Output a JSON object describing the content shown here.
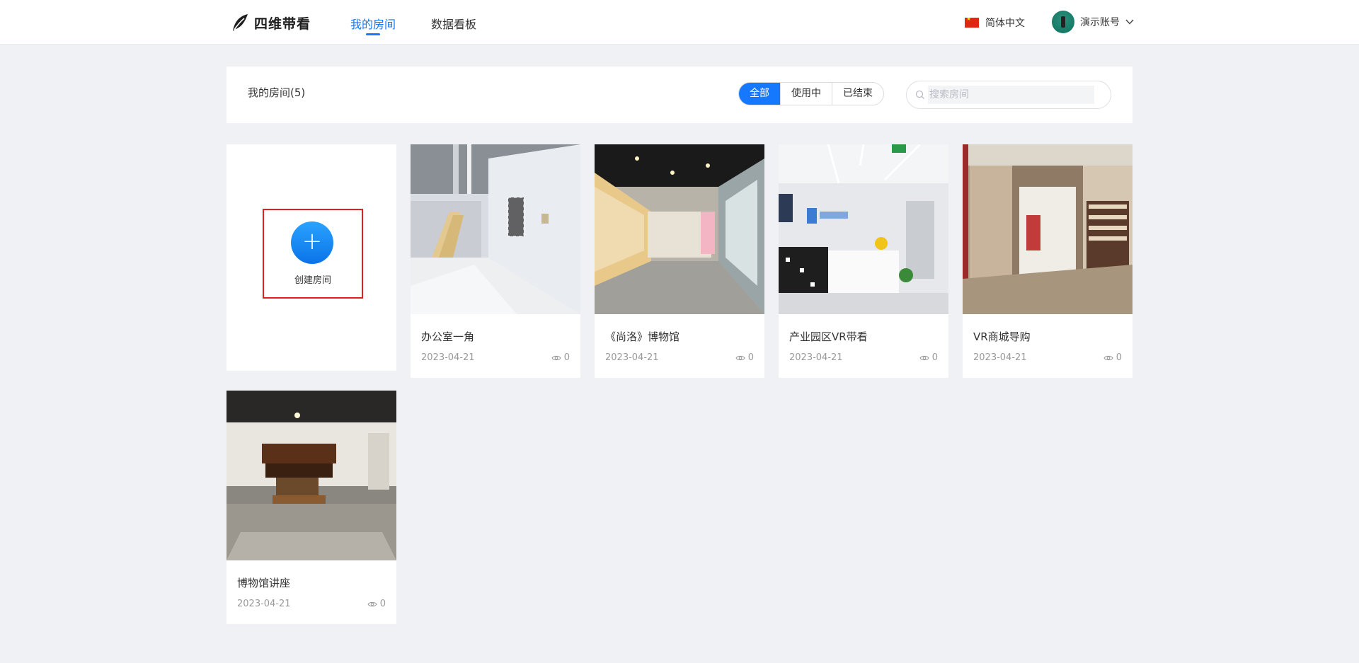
{
  "nav": {
    "logo_text": "四维带看",
    "tabs": [
      {
        "label": "我的房间",
        "active": true
      },
      {
        "label": "数据看板",
        "active": false
      }
    ],
    "language": "简体中文",
    "account": "演示账号"
  },
  "header": {
    "title": "我的房间(5)",
    "filters": [
      {
        "label": "全部",
        "active": true
      },
      {
        "label": "使用中",
        "active": false
      },
      {
        "label": "已结束",
        "active": false
      }
    ],
    "search_placeholder": "搜索房间"
  },
  "create_card": {
    "label": "创建房间"
  },
  "rooms": [
    {
      "name": "办公室一角",
      "date": "2023-04-21",
      "views": "0"
    },
    {
      "name": "《尚洛》博物馆",
      "date": "2023-04-21",
      "views": "0"
    },
    {
      "name": "产业园区VR带看",
      "date": "2023-04-21",
      "views": "0"
    },
    {
      "name": "VR商城导购",
      "date": "2023-04-21",
      "views": "0"
    },
    {
      "name": "博物馆讲座",
      "date": "2023-04-21",
      "views": "0"
    }
  ],
  "colors": {
    "accent": "#1677ff",
    "background": "#eff1f5",
    "highlight_border": "#e02020"
  }
}
